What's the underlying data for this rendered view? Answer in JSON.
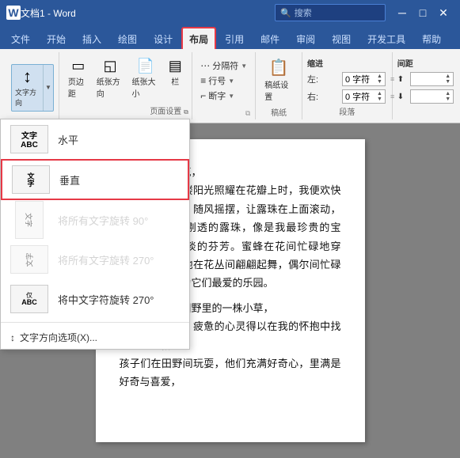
{
  "titleBar": {
    "appName": "文档1 - Word",
    "searchPlaceholder": "搜索",
    "controls": [
      "—",
      "□",
      "✕"
    ]
  },
  "ribbon": {
    "tabs": [
      {
        "label": "文件",
        "active": false
      },
      {
        "label": "开始",
        "active": false
      },
      {
        "label": "插入",
        "active": false
      },
      {
        "label": "绘图",
        "active": false
      },
      {
        "label": "设计",
        "active": false
      },
      {
        "label": "布局",
        "active": true,
        "highlighted": true
      },
      {
        "label": "引用",
        "active": false
      },
      {
        "label": "邮件",
        "active": false
      },
      {
        "label": "审阅",
        "active": false
      },
      {
        "label": "视图",
        "active": false
      },
      {
        "label": "开发工具",
        "active": false
      },
      {
        "label": "帮助",
        "active": false
      }
    ],
    "groups": {
      "pageSetup": {
        "label": "页面设置",
        "buttons": [
          {
            "id": "text-direction",
            "icon": "↕",
            "label": "文字方向",
            "hasDropdown": true,
            "active": true
          },
          {
            "id": "margins",
            "icon": "▭",
            "label": "页边距"
          },
          {
            "id": "orientation",
            "icon": "◱",
            "label": "纸张方向"
          },
          {
            "id": "size",
            "icon": "▭",
            "label": "纸张大小"
          },
          {
            "id": "columns",
            "icon": "▤",
            "label": "栏"
          }
        ]
      },
      "flow": {
        "buttons": [
          {
            "label": "分隔符",
            "arrow": true
          },
          {
            "label": "行号",
            "arrow": true
          },
          {
            "label": "断字",
            "arrow": true
          }
        ]
      },
      "draft": {
        "label": "稿纸",
        "buttons": [
          {
            "label": "稿纸设置"
          }
        ]
      },
      "indent": {
        "label": "缩进",
        "left_label": "左:",
        "left_value": "0 字符",
        "right_label": "右:",
        "right_value": "0 字符"
      },
      "spacing": {
        "label": "间距",
        "before_icon": "≡",
        "after_icon": "≡"
      }
    }
  },
  "dropdown": {
    "items": [
      {
        "id": "horizontal",
        "label": "水平",
        "icon": "horizontal",
        "disabled": false
      },
      {
        "id": "vertical",
        "label": "垂直",
        "icon": "vertical",
        "disabled": false,
        "selected": true
      },
      {
        "id": "rotate90",
        "label": "将所有文字旋转 90°",
        "icon": "rotate90",
        "disabled": true
      },
      {
        "id": "rotate270",
        "label": "将所有文字旋转 270°",
        "icon": "rotate270",
        "disabled": true
      },
      {
        "id": "chinese270",
        "label": "将中文字符旋转 270°",
        "icon": "chinese270",
        "disabled": false
      }
    ],
    "linkLabel": "文字方向选项(X)..."
  },
  "document": {
    "paragraphs": [
      "我想变成一朵花，",
      "清晨，当第一缕阳光照耀在花瓣上时，我便欢快地舒展着自己，随风摇摆，让露珠在上面滚动，那一颗颗晶莹剔透的露珠，像是我最珍贵的宝石，散发出淡淡的芬芳。蜜蜂在花间忙碌地穿梭，蝴蝶轻盈地在花丛间翩翩起舞，偶尔间忙碌地采蜜，我成为它们最爱的乐园。",
      "　　我想成为田野里的一株小草，",
      "在田间劳作时，疲惫的心灵得以在我的怀抱中找到一丝慰藉。",
      "孩子们在田野间玩耍，他们充满好奇心，里满是好奇与喜爱，"
    ]
  }
}
